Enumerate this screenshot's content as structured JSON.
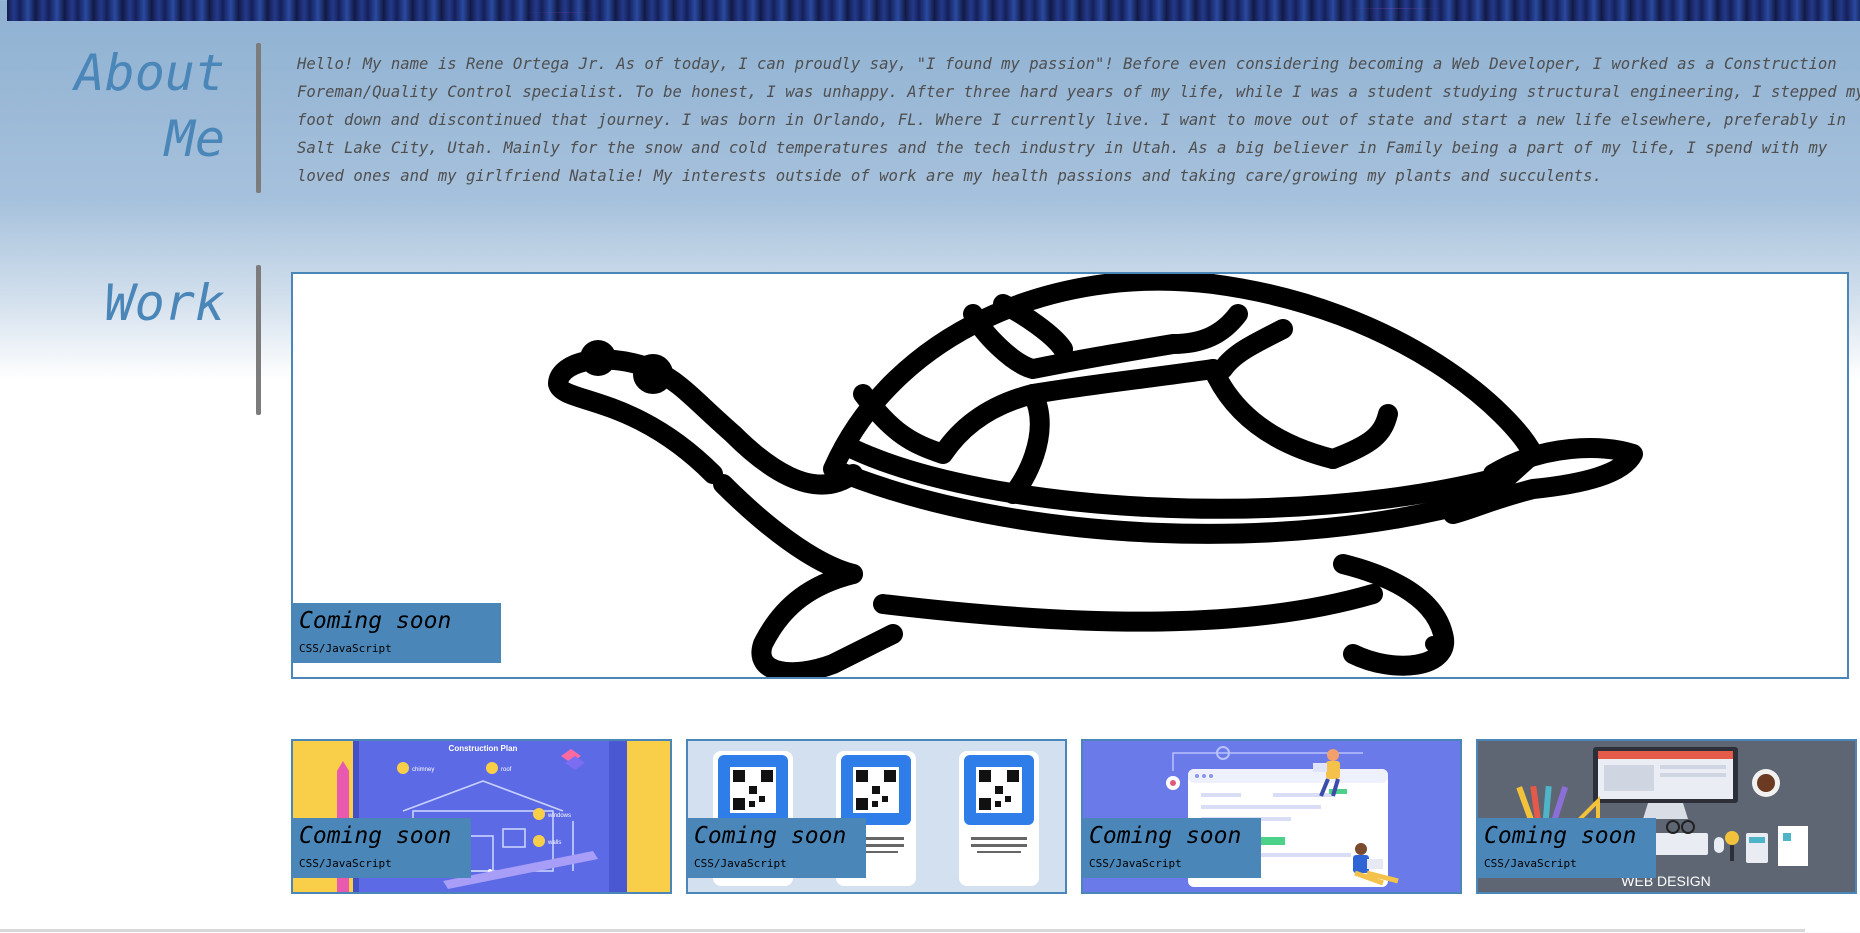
{
  "colors": {
    "accent": "#4a86b8",
    "divider": "#7c7c7c",
    "text": "#4f4f4f"
  },
  "about": {
    "title": "About Me",
    "text": "Hello! My name is Rene Ortega Jr. As of today, I can proudly say, \"I found my passion\"! Before even considering becoming a Web Developer, I worked as a Construction\nForeman/Quality Control specialist. To be honest, I was unhappy. After three hard years of my life, while I was a student studying structural engineering, I stepped my\nfoot down and discontinued that journey. I was born in Orlando, FL. Where I currently live. I want to move out of state and start a new life elsewhere, preferably in\nSalt Lake City, Utah. Mainly for the snow and cold temperatures and the tech industry in Utah. As a big believer in Family being a part of my life, I spend with my\nloved ones and my girlfriend Natalie! My interests outside of work are my health passions and taking care/growing my plants and succulents."
  },
  "work": {
    "title": "Work",
    "featured": {
      "caption": "Coming soon",
      "tech": "CSS/JavaScript",
      "image": "turtle-outline-icon"
    },
    "projects": [
      {
        "caption": "Coming soon",
        "tech": "CSS/JavaScript",
        "image": "construction-plan-blueprint",
        "image_label": "Construction Plan",
        "labels": [
          "chimney",
          "roof",
          "windows",
          "walls"
        ]
      },
      {
        "caption": "Coming soon",
        "tech": "CSS/JavaScript",
        "image": "qr-code-cards"
      },
      {
        "caption": "Coming soon",
        "tech": "CSS/JavaScript",
        "image": "web-illustration"
      },
      {
        "caption": "Coming soon",
        "tech": "CSS/JavaScript",
        "image": "web-design-desk",
        "image_label": "WEB DESIGN"
      }
    ]
  }
}
